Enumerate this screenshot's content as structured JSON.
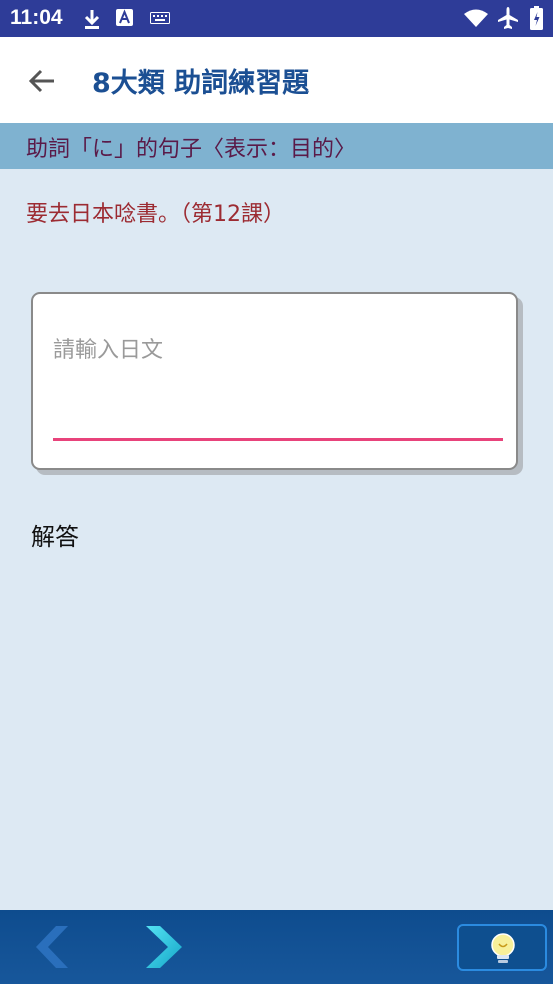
{
  "status_bar": {
    "time": "11:04",
    "icons": [
      "download-icon",
      "a-badge-icon",
      "keyboard-icon",
      "wifi-icon",
      "airplane-icon",
      "battery-icon"
    ]
  },
  "app_bar": {
    "back_icon": "arrow-left-icon",
    "title": "8大類 助詞練習題"
  },
  "section": {
    "header": "助詞「に」的句子〈表示：目的〉"
  },
  "question": {
    "text": "要去日本唸書。（第12課）"
  },
  "answer_input": {
    "value": "",
    "placeholder": "請輸入日文",
    "underline_color": "#e8437b"
  },
  "answer": {
    "label": "解答"
  },
  "bottom_bar": {
    "prev_icon": "chevron-left-icon",
    "next_icon": "chevron-right-icon",
    "hint_icon": "lightbulb-icon"
  },
  "colors": {
    "status_bar": "#2e3c98",
    "title": "#1b4f93",
    "section_header_bg": "#7fb2d0",
    "section_header_text": "#5a1a48",
    "question_text": "#9c2b32",
    "background": "#dde9f3",
    "bottom_bar": "#0e4c8e"
  }
}
